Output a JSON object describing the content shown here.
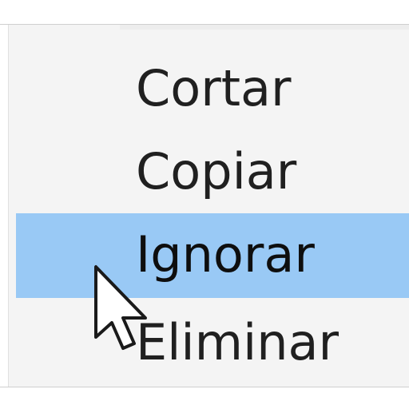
{
  "context_menu": {
    "items": [
      {
        "label": "Cortar",
        "highlighted": false
      },
      {
        "label": "Copiar",
        "highlighted": false
      },
      {
        "label": "Ignorar",
        "highlighted": true
      },
      {
        "label": "Eliminar",
        "highlighted": false
      }
    ],
    "highlight_color": "#99c9f5",
    "background_color": "#f4f4f4"
  },
  "cursor": {
    "icon": "arrow-pointer-icon"
  }
}
